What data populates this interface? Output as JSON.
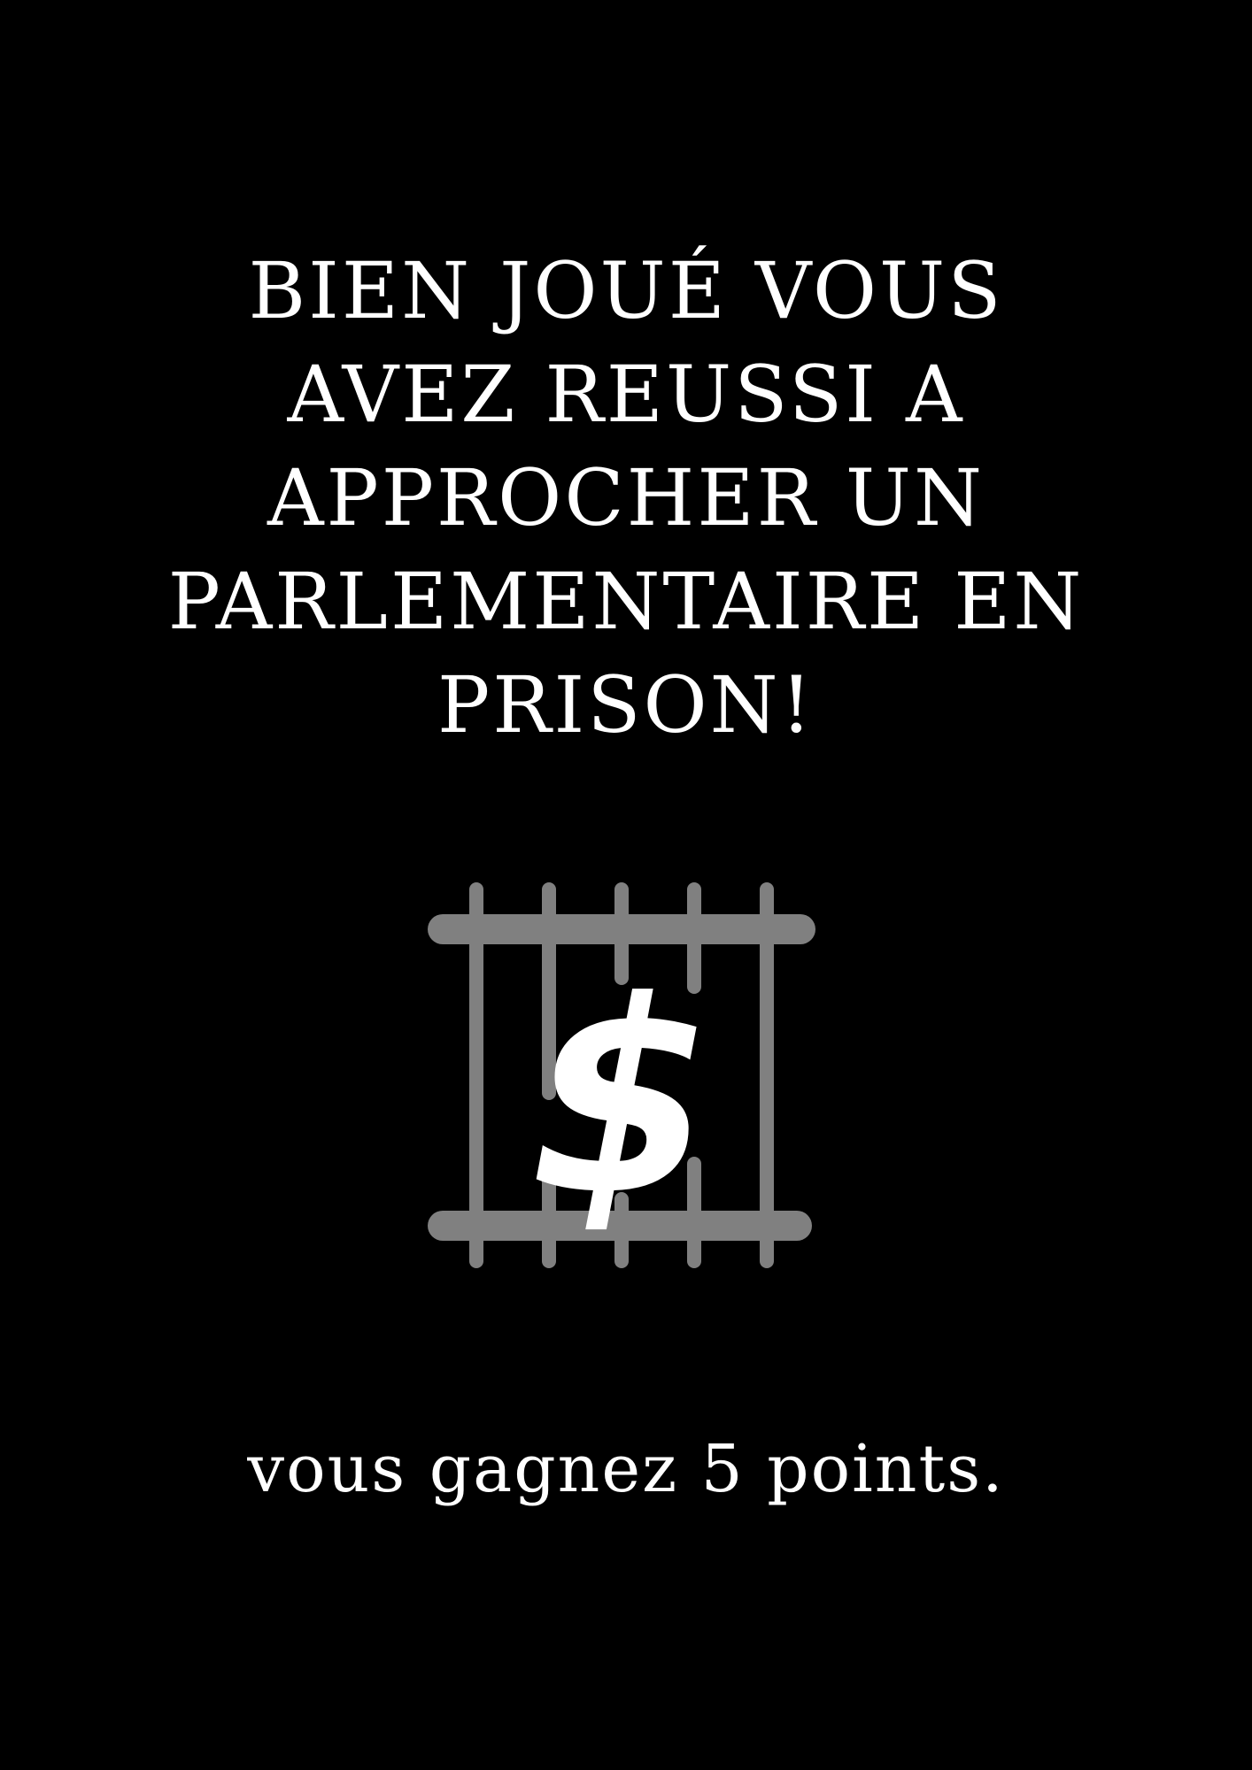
{
  "card": {
    "title_lines": [
      "BIEN JOUÉ VOUS",
      "AVEZ REUSSI A",
      "APPROCHER UN",
      "PARLEMENTAIRE EN",
      "PRISON!"
    ],
    "footer": "vous gagnez 5 points.",
    "icon": "jailed-dollar-icon",
    "icon_glyph": "$"
  },
  "colors": {
    "background": "#000000",
    "text": "#ffffff",
    "bars": "#808080"
  }
}
